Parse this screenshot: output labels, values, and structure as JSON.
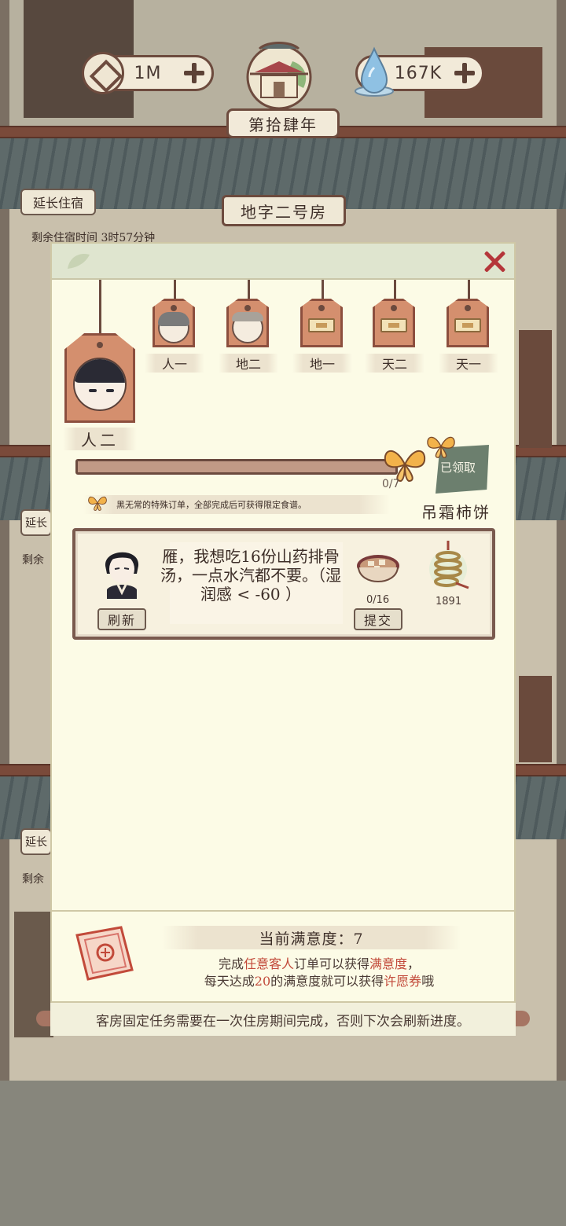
{
  "top_bar": {
    "coins": "1M",
    "water": "167K",
    "year": "第拾肆年"
  },
  "room": {
    "extend_label": "延长住宿",
    "title": "地字二号房",
    "remain_text": "剩余住宿时间 3时57分钟",
    "side_stub_1": "延长",
    "side_stub_2": "延长",
    "side_remain_1": "剩余",
    "side_remain_2": "剩余"
  },
  "panel": {
    "current_guest": "人二",
    "tags": [
      {
        "label": "人一",
        "state": "guest-gray"
      },
      {
        "label": "地二",
        "state": "guest-bald"
      },
      {
        "label": "地一",
        "state": "locked"
      },
      {
        "label": "天二",
        "state": "locked"
      },
      {
        "label": "天一",
        "state": "locked"
      }
    ],
    "progress": {
      "current": 0,
      "total": 7,
      "text": "0/7"
    },
    "reward": {
      "claimed_label": "已领取",
      "name": "吊霜柿饼"
    },
    "hint": "黑无常的特殊订单，全部完成后可获得限定食谱。",
    "order": {
      "request_text": "雁，我想吃16份山药排骨汤，一点水汽都不要。（湿润感 < -60 ）",
      "refresh_label": "刷新",
      "submit_label": "提交",
      "progress_text": "0/16",
      "coin_reward": "1891"
    },
    "satisfaction": {
      "title": "当前满意度：7",
      "line1_a": "完成",
      "line1_b": "任意客人",
      "line1_c": "订单可以获得",
      "line1_d": "满意度",
      "line1_e": "，",
      "line2_a": "每天达成",
      "line2_b": "20",
      "line2_c": "的满意度就可以获得",
      "line2_d": "许愿券",
      "line2_e": "哦"
    },
    "bottom_note": "客房固定任务需要在一次住房期间完成，否则下次会刷新进度。"
  },
  "colors": {
    "panel_bg": "#fcfbe6",
    "tag_plate": "#d48f6e",
    "accent_red": "#c24a3a",
    "close_red": "#b5363a",
    "reward_green": "#6c7f6e"
  }
}
